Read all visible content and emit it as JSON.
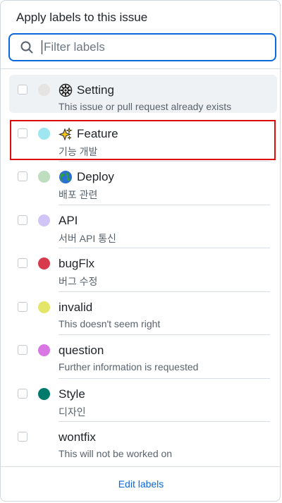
{
  "title": "Apply labels to this issue",
  "search": {
    "placeholder": "Filter labels",
    "value": ""
  },
  "labels": [
    {
      "name": "Setting",
      "description": "This issue or pull request already exists",
      "color": "#e6e3e3",
      "icon": "gear-icon"
    },
    {
      "name": "Feature",
      "description": "기능 개발",
      "color": "#9ee7f0",
      "icon": "sparkles-icon"
    },
    {
      "name": "Deploy",
      "description": "배포 관련",
      "color": "#bfdebf",
      "icon": "globe-icon"
    },
    {
      "name": "API",
      "description": "서버 API 통신",
      "color": "#d1c4f7",
      "icon": ""
    },
    {
      "name": "bugFlx",
      "description": "버그 수정",
      "color": "#d73a4a",
      "icon": ""
    },
    {
      "name": "invalid",
      "description": "This doesn't seem right",
      "color": "#e4e669",
      "icon": ""
    },
    {
      "name": "question",
      "description": "Further information is requested",
      "color": "#d876e3",
      "icon": ""
    },
    {
      "name": "Style",
      "description": "디자인",
      "color": "#007a6b",
      "icon": ""
    },
    {
      "name": "wontfix",
      "description": "This will not be worked on",
      "color": "#ffffff",
      "icon": ""
    }
  ],
  "footer": {
    "edit_label": "Edit labels"
  }
}
